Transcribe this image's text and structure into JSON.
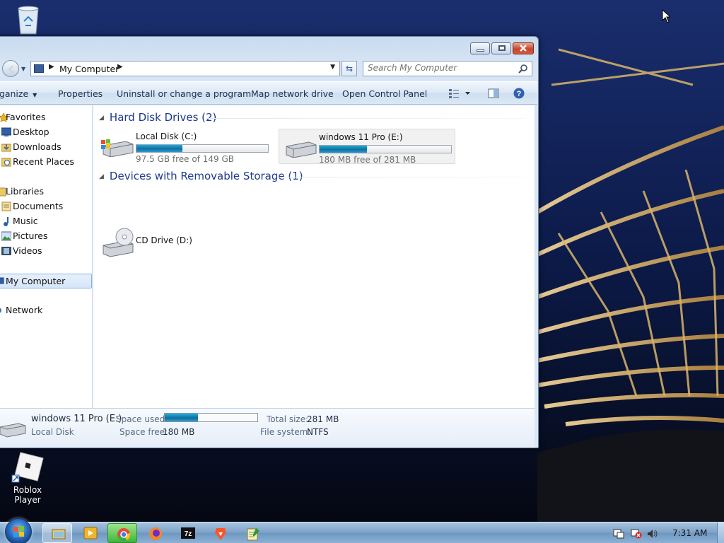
{
  "desktop": {
    "icons": [
      {
        "label": "",
        "icon": "recycle-bin-icon"
      },
      {
        "label": "Roblox Player",
        "icon": "roblox-icon"
      }
    ]
  },
  "window": {
    "address": {
      "path": "My Computer"
    },
    "search": {
      "placeholder": "Search My Computer"
    },
    "commands": {
      "organize": "rganize",
      "properties": "Properties",
      "uninstall": "Uninstall or change a program",
      "map_drive": "Map network drive",
      "control_panel": "Open Control Panel"
    },
    "nav": {
      "favorites": "Favorites",
      "desktop": "Desktop",
      "downloads": "Downloads",
      "recent": "Recent Places",
      "libraries": "Libraries",
      "documents": "Documents",
      "music": "Music",
      "pictures": "Pictures",
      "videos": "Videos",
      "my_computer": "My Computer",
      "network": "Network"
    },
    "groups": {
      "hdd": "Hard Disk Drives (2)",
      "removable": "Devices with Removable Storage (1)"
    },
    "drives": [
      {
        "name": "Local Disk (C:)",
        "free": "97.5 GB free of 149 GB",
        "used_fraction": 0.35
      },
      {
        "name": "windows 11 Pro (E:)",
        "free": "180 MB free of 281 MB",
        "used_fraction": 0.36
      }
    ],
    "removable": [
      {
        "name": "CD Drive (D:)"
      }
    ],
    "details": {
      "name": "windows 11 Pro (E:)",
      "type": "Local Disk",
      "space_used_label": "Space used:",
      "space_used_fraction": 0.36,
      "space_free_label": "Space free:",
      "space_free": "180 MB",
      "total_size_label": "Total size:",
      "total_size": "281 MB",
      "file_system_label": "File system:",
      "file_system": "NTFS"
    }
  },
  "taskbar": {
    "clock": "7:31 AM",
    "pinned": [
      "explorer-icon",
      "media-player-icon",
      "chrome-icon",
      "firefox-icon",
      "7zip-icon",
      "brave-icon",
      "notepad-icon"
    ]
  },
  "colors": {
    "accent": "#1e3a8a",
    "bar_fill": "#1fa9d6",
    "taskbar": "#7ea3c8"
  }
}
